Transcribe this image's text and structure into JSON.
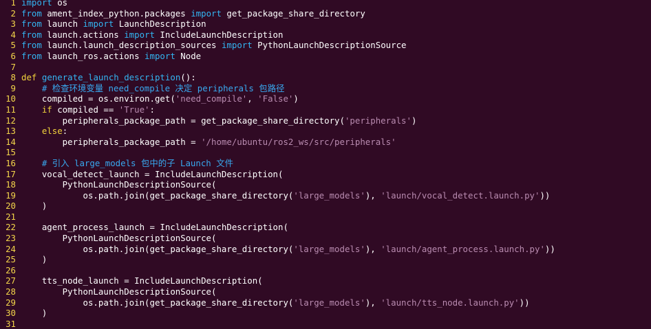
{
  "colors": {
    "background": "#300a24",
    "line_number": "#f3d54a",
    "keyword": "#33b5f2",
    "control_keyword": "#f1d33b",
    "string": "#b98bb0",
    "comment": "#38a9f0",
    "text": "#ffffff"
  },
  "lines": [
    {
      "n": "1",
      "tokens": [
        {
          "t": "import",
          "c": "kw"
        },
        {
          "t": " os",
          "c": "plain"
        }
      ]
    },
    {
      "n": "2",
      "tokens": [
        {
          "t": "from",
          "c": "kw"
        },
        {
          "t": " ament_index_python.packages ",
          "c": "plain"
        },
        {
          "t": "import",
          "c": "kw"
        },
        {
          "t": " get_package_share_directory",
          "c": "plain"
        }
      ]
    },
    {
      "n": "3",
      "tokens": [
        {
          "t": "from",
          "c": "kw"
        },
        {
          "t": " launch ",
          "c": "plain"
        },
        {
          "t": "import",
          "c": "kw"
        },
        {
          "t": " LaunchDescription",
          "c": "plain"
        }
      ]
    },
    {
      "n": "4",
      "tokens": [
        {
          "t": "from",
          "c": "kw"
        },
        {
          "t": " launch.actions ",
          "c": "plain"
        },
        {
          "t": "import",
          "c": "kw"
        },
        {
          "t": " IncludeLaunchDescription",
          "c": "plain"
        }
      ]
    },
    {
      "n": "5",
      "tokens": [
        {
          "t": "from",
          "c": "kw"
        },
        {
          "t": " launch.launch_description_sources ",
          "c": "plain"
        },
        {
          "t": "import",
          "c": "kw"
        },
        {
          "t": " PythonLaunchDescriptionSource",
          "c": "plain"
        }
      ]
    },
    {
      "n": "6",
      "tokens": [
        {
          "t": "from",
          "c": "kw"
        },
        {
          "t": " launch_ros.actions ",
          "c": "plain"
        },
        {
          "t": "import",
          "c": "kw"
        },
        {
          "t": " Node",
          "c": "plain"
        }
      ]
    },
    {
      "n": "7",
      "tokens": []
    },
    {
      "n": "8",
      "tokens": [
        {
          "t": "def",
          "c": "kw2"
        },
        {
          "t": " ",
          "c": "plain"
        },
        {
          "t": "generate_launch_description",
          "c": "fn"
        },
        {
          "t": "():",
          "c": "plain"
        }
      ]
    },
    {
      "n": "9",
      "tokens": [
        {
          "t": "    # 检查环境变量 need_compile 决定 peripherals 包路径",
          "c": "cm"
        }
      ]
    },
    {
      "n": "10",
      "tokens": [
        {
          "t": "    compiled = os.environ.get(",
          "c": "plain"
        },
        {
          "t": "'need_compile'",
          "c": "str"
        },
        {
          "t": ", ",
          "c": "plain"
        },
        {
          "t": "'False'",
          "c": "str"
        },
        {
          "t": ")",
          "c": "plain"
        }
      ]
    },
    {
      "n": "11",
      "tokens": [
        {
          "t": "    ",
          "c": "plain"
        },
        {
          "t": "if",
          "c": "kw2"
        },
        {
          "t": " compiled == ",
          "c": "plain"
        },
        {
          "t": "'True'",
          "c": "str"
        },
        {
          "t": ":",
          "c": "plain"
        }
      ]
    },
    {
      "n": "12",
      "tokens": [
        {
          "t": "        peripherals_package_path = get_package_share_directory(",
          "c": "plain"
        },
        {
          "t": "'peripherals'",
          "c": "str"
        },
        {
          "t": ")",
          "c": "plain"
        }
      ]
    },
    {
      "n": "13",
      "tokens": [
        {
          "t": "    ",
          "c": "plain"
        },
        {
          "t": "else",
          "c": "kw2"
        },
        {
          "t": ":",
          "c": "plain"
        }
      ]
    },
    {
      "n": "14",
      "tokens": [
        {
          "t": "        peripherals_package_path = ",
          "c": "plain"
        },
        {
          "t": "'/home/ubuntu/ros2_ws/src/peripherals'",
          "c": "str"
        }
      ]
    },
    {
      "n": "15",
      "tokens": []
    },
    {
      "n": "16",
      "tokens": [
        {
          "t": "    # 引入 large_models 包中的子 Launch 文件",
          "c": "cm"
        }
      ]
    },
    {
      "n": "17",
      "tokens": [
        {
          "t": "    vocal_detect_launch = IncludeLaunchDescription(",
          "c": "plain"
        }
      ]
    },
    {
      "n": "18",
      "tokens": [
        {
          "t": "        PythonLaunchDescriptionSource(",
          "c": "plain"
        }
      ]
    },
    {
      "n": "19",
      "tokens": [
        {
          "t": "            os.path.join(get_package_share_directory(",
          "c": "plain"
        },
        {
          "t": "'large_models'",
          "c": "str"
        },
        {
          "t": "), ",
          "c": "plain"
        },
        {
          "t": "'launch/vocal_detect.launch.py'",
          "c": "str"
        },
        {
          "t": "))",
          "c": "plain"
        }
      ]
    },
    {
      "n": "20",
      "tokens": [
        {
          "t": "    )",
          "c": "plain"
        }
      ]
    },
    {
      "n": "21",
      "tokens": []
    },
    {
      "n": "22",
      "tokens": [
        {
          "t": "    agent_process_launch = IncludeLaunchDescription(",
          "c": "plain"
        }
      ]
    },
    {
      "n": "23",
      "tokens": [
        {
          "t": "        PythonLaunchDescriptionSource(",
          "c": "plain"
        }
      ]
    },
    {
      "n": "24",
      "tokens": [
        {
          "t": "            os.path.join(get_package_share_directory(",
          "c": "plain"
        },
        {
          "t": "'large_models'",
          "c": "str"
        },
        {
          "t": "), ",
          "c": "plain"
        },
        {
          "t": "'launch/agent_process.launch.py'",
          "c": "str"
        },
        {
          "t": "))",
          "c": "plain"
        }
      ]
    },
    {
      "n": "25",
      "tokens": [
        {
          "t": "    )",
          "c": "plain"
        }
      ]
    },
    {
      "n": "26",
      "tokens": []
    },
    {
      "n": "27",
      "tokens": [
        {
          "t": "    tts_node_launch = IncludeLaunchDescription(",
          "c": "plain"
        }
      ]
    },
    {
      "n": "28",
      "tokens": [
        {
          "t": "        PythonLaunchDescriptionSource(",
          "c": "plain"
        }
      ]
    },
    {
      "n": "29",
      "tokens": [
        {
          "t": "            os.path.join(get_package_share_directory(",
          "c": "plain"
        },
        {
          "t": "'large_models'",
          "c": "str"
        },
        {
          "t": "), ",
          "c": "plain"
        },
        {
          "t": "'launch/tts_node.launch.py'",
          "c": "str"
        },
        {
          "t": "))",
          "c": "plain"
        }
      ]
    },
    {
      "n": "30",
      "tokens": [
        {
          "t": "    )",
          "c": "plain"
        }
      ]
    },
    {
      "n": "31",
      "tokens": []
    }
  ]
}
